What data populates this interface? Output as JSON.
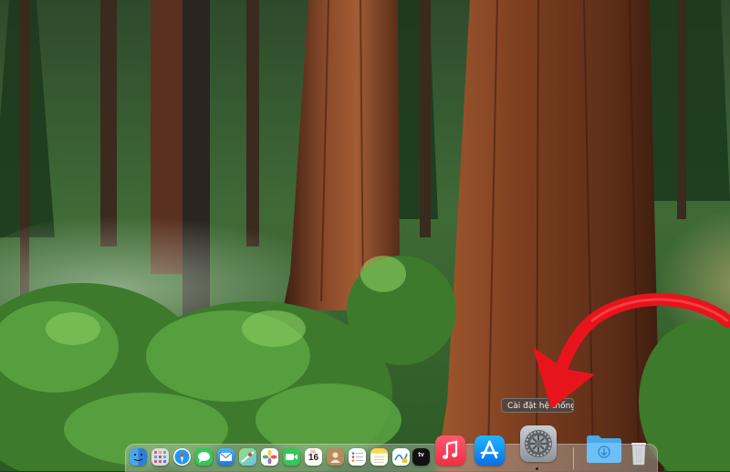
{
  "desktop": {
    "wallpaper": "redwood-forest-wallpaper"
  },
  "tooltip": {
    "text": "Cài đặt hệ thống"
  },
  "dock": {
    "calendar_day": "16",
    "calendar_month": "JUL",
    "appletv_label": "tv",
    "items": [
      {
        "name": "finder",
        "icon": "finder-icon"
      },
      {
        "name": "launchpad",
        "icon": "launchpad-icon"
      },
      {
        "name": "safari",
        "icon": "safari-icon"
      },
      {
        "name": "messages",
        "icon": "messages-icon"
      },
      {
        "name": "mail",
        "icon": "mail-icon"
      },
      {
        "name": "maps",
        "icon": "maps-icon"
      },
      {
        "name": "photos",
        "icon": "photos-icon"
      },
      {
        "name": "facetime",
        "icon": "facetime-icon"
      },
      {
        "name": "calendar",
        "icon": "calendar-icon"
      },
      {
        "name": "contacts",
        "icon": "contacts-icon"
      },
      {
        "name": "reminders",
        "icon": "reminders-icon"
      },
      {
        "name": "notes",
        "icon": "notes-icon"
      },
      {
        "name": "freeform",
        "icon": "freeform-icon"
      },
      {
        "name": "appletv",
        "icon": "appletv-icon"
      },
      {
        "name": "music",
        "icon": "music-icon"
      },
      {
        "name": "app-store",
        "icon": "app-store-icon"
      },
      {
        "name": "system-settings",
        "icon": "system-settings-icon"
      },
      {
        "name": "downloads",
        "icon": "downloads-folder-icon"
      },
      {
        "name": "trash",
        "icon": "trash-icon"
      }
    ]
  },
  "annotation": {
    "arrow_color": "#e8141b"
  }
}
